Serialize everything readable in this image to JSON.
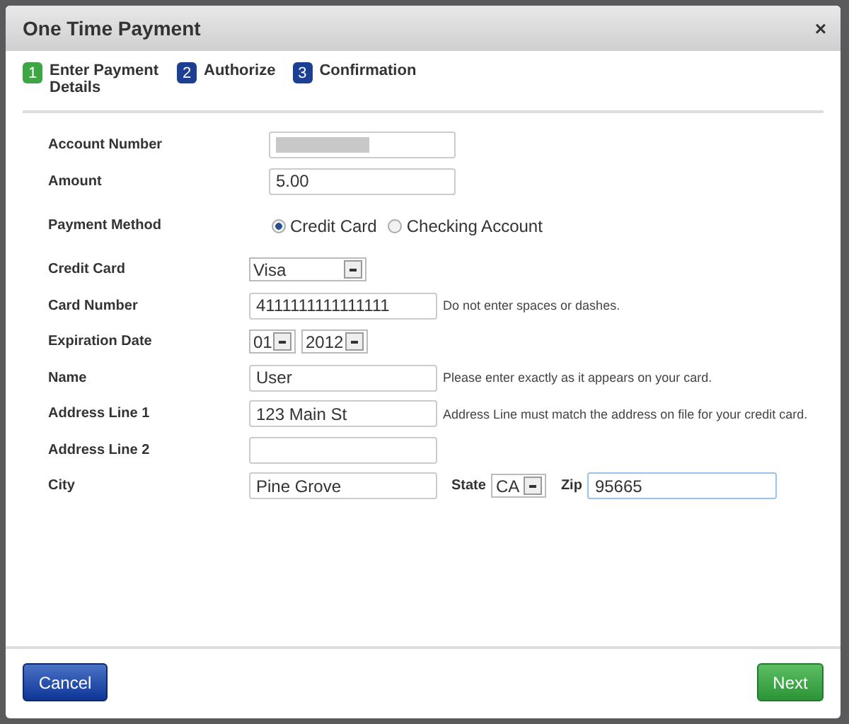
{
  "window": {
    "title": "One Time Payment",
    "close": "×"
  },
  "steps": [
    {
      "number": "1",
      "label": "Enter Payment Details",
      "selected": true
    },
    {
      "number": "2",
      "label": "Authorize",
      "selected": false
    },
    {
      "number": "3",
      "label": "Confirmation",
      "selected": false
    }
  ],
  "fields": [
    {
      "kind": "redacted",
      "label": "Account Number"
    },
    {
      "kind": "text",
      "label": "Amount",
      "value": "5.00"
    },
    {
      "kind": "radio",
      "label": "Payment Method",
      "options": [
        {
          "label": "Credit Card",
          "selected": true
        },
        {
          "label": "Checking Account",
          "selected": false
        }
      ]
    },
    {
      "kind": "select",
      "label": "Credit Card",
      "value": "Visa"
    },
    {
      "kind": "text",
      "label": "Card Number",
      "value": "4111111111111111",
      "hint": "Do not enter spaces or dashes."
    },
    {
      "kind": "date",
      "label": "Expiration Date",
      "month": "01",
      "year": "2012"
    },
    {
      "kind": "text",
      "label": "Name",
      "value": "User",
      "hint": "Please enter exactly as it appears on your card."
    },
    {
      "kind": "text",
      "label": "Address Line 1",
      "value": "123 Main St",
      "hint": "Address Line must match the address on file for your credit card."
    },
    {
      "kind": "text",
      "label": "Address Line 2"
    },
    {
      "kind": "city",
      "label": "City",
      "value": "Pine Grove",
      "state_label": "State",
      "state": "CA",
      "zip_label": "Zip",
      "zip": "95665"
    }
  ],
  "buttons": {
    "cancel": "Cancel",
    "next": "Next"
  }
}
